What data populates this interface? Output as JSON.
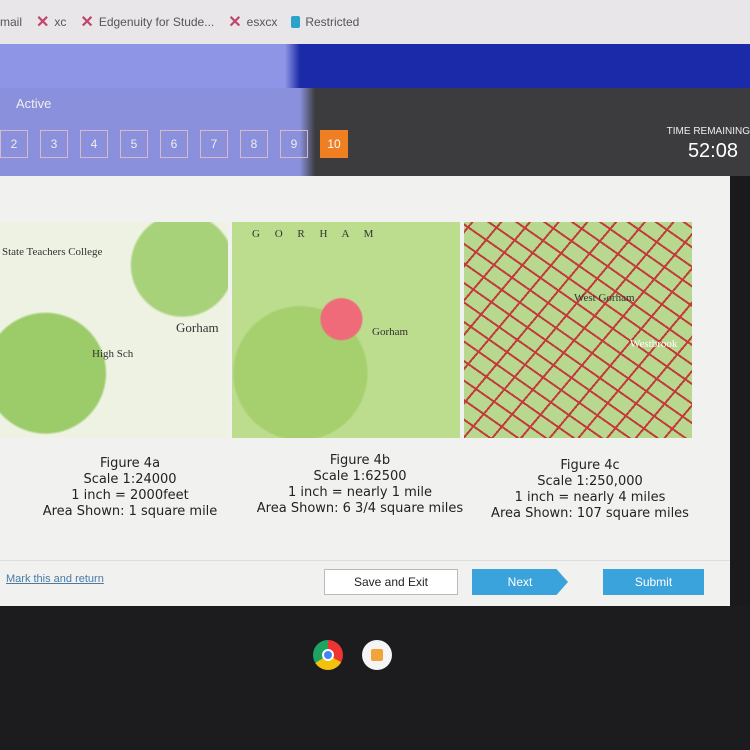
{
  "bookmarks": [
    {
      "label": "mail",
      "icon": "none"
    },
    {
      "label": "xc",
      "icon": "x-icon"
    },
    {
      "label": "Edgenuity for Stude...",
      "icon": "x-icon"
    },
    {
      "label": "esxcx",
      "icon": "x-icon"
    },
    {
      "label": "Restricted",
      "icon": "lock-icon"
    }
  ],
  "nav": {
    "status": "Active",
    "questions": [
      "2",
      "3",
      "4",
      "5",
      "6",
      "7",
      "8",
      "9",
      "10"
    ],
    "current": "10",
    "accent": "#f07e22",
    "time_label": "TIME REMAINING",
    "time": "52:08"
  },
  "maps": [
    {
      "labels": [
        "State Teachers College",
        "Gorham",
        "High Sch"
      ]
    },
    {
      "labels": [
        "G O R H A M",
        "Gorham"
      ]
    },
    {
      "labels": [
        "West Gorham",
        "Westbrook"
      ]
    }
  ],
  "captions": [
    {
      "title": "Figure 4a",
      "scale": "Scale 1:24000",
      "ratio": "1 inch = 2000feet",
      "area": "Area Shown: 1 square mile"
    },
    {
      "title": "Figure 4b",
      "scale": "Scale 1:62500",
      "ratio": "1 inch = nearly 1 mile",
      "area": "Area Shown: 6 3/4 square miles"
    },
    {
      "title": "Figure 4c",
      "scale": "Scale 1:250,000",
      "ratio": "1 inch = nearly 4 miles",
      "area": "Area Shown: 107 square miles"
    }
  ],
  "footer": {
    "mark": "Mark this and return",
    "save": "Save and Exit",
    "next": "Next",
    "submit": "Submit",
    "button_color": "#3aa3dc"
  }
}
